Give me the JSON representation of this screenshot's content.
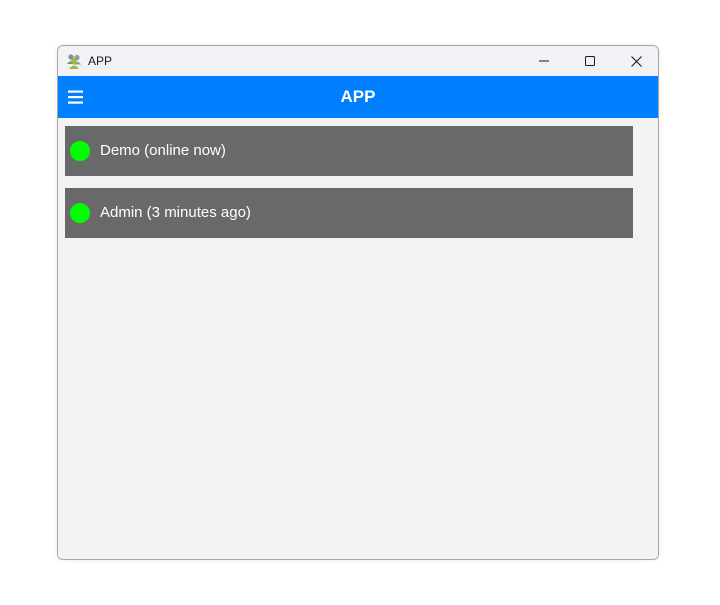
{
  "window": {
    "title": "APP",
    "app_icon": "users-icon",
    "controls": {
      "minimize": "minimize-icon",
      "maximize": "maximize-icon",
      "close": "close-icon"
    }
  },
  "appbar": {
    "title": "APP",
    "menu_icon": "hamburger-menu-icon",
    "color": "#007fff"
  },
  "users": [
    {
      "label": "Demo (online now)",
      "status_color": "#00ff00"
    },
    {
      "label": "Admin (3 minutes ago)",
      "status_color": "#00ff00"
    }
  ],
  "colors": {
    "row_background": "#696969",
    "content_background": "#f3f3f3"
  }
}
